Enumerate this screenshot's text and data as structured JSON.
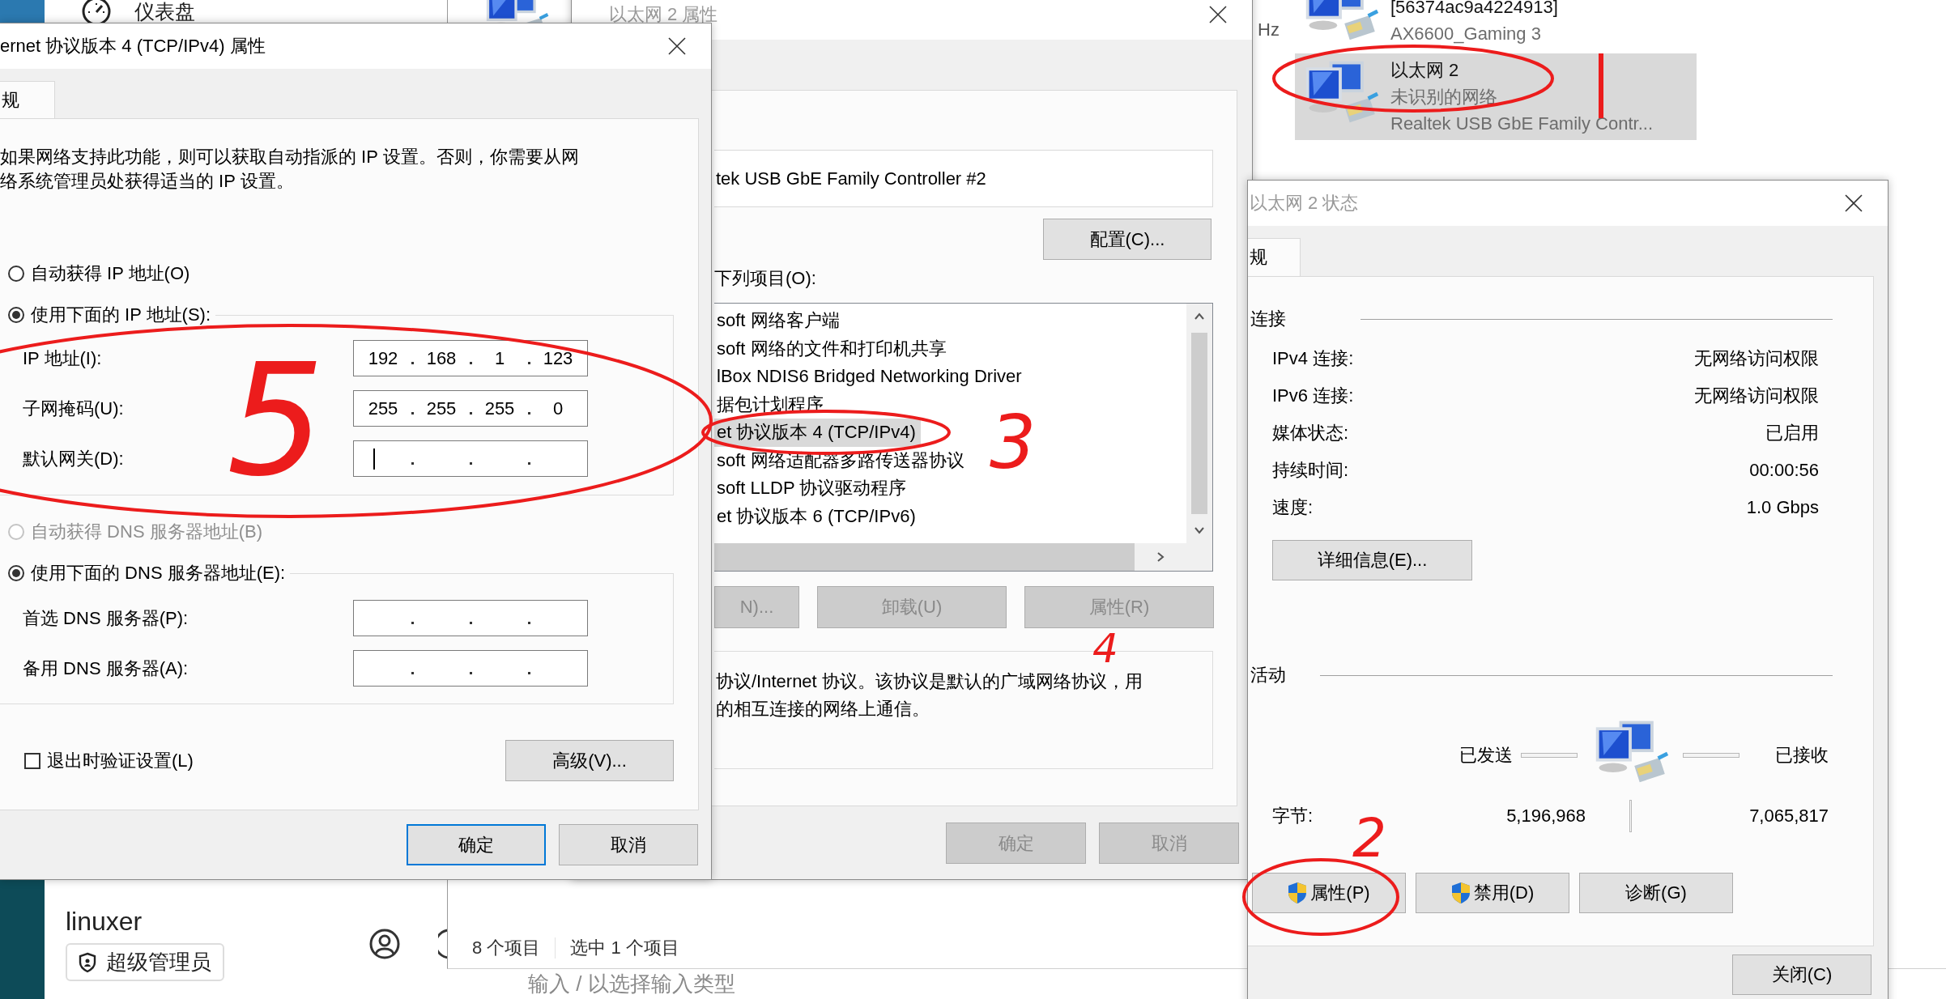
{
  "background_page": {
    "heading": "仪表盘",
    "user_name": "linuxer",
    "role_badge": "超级管理员",
    "input_hint": "输入 / 以选择输入类型"
  },
  "explorer": {
    "column_fragment": "Hz",
    "connections": [
      {
        "lines": [
          "[56374ac9a4224913]",
          "AX6600_Gaming 3"
        ],
        "selected": false
      },
      {
        "lines": [
          "以太网 2",
          "未识别的网络",
          "Realtek USB GbE Family Contr..."
        ],
        "selected": true
      }
    ],
    "status_items": [
      "8 个项目",
      "选中 1 个项目"
    ]
  },
  "adapter_properties": {
    "title": "以太网 2 属性",
    "adapter": "tek USB GbE Family Controller #2",
    "configure_button": "配置(C)...",
    "items_label": "下列项目(O):",
    "items": [
      {
        "label": "soft 网络客户端",
        "selected": false
      },
      {
        "label": "soft 网络的文件和打印机共享",
        "selected": false
      },
      {
        "label": "lBox NDIS6 Bridged Networking Driver",
        "selected": false
      },
      {
        "label": "据包计划程序",
        "selected": false
      },
      {
        "label": "et 协议版本 4 (TCP/IPv4)",
        "selected": true
      },
      {
        "label": "soft 网络适配器多路传送器协议",
        "selected": false
      },
      {
        "label": "soft LLDP 协议驱动程序",
        "selected": false
      },
      {
        "label": "et 协议版本 6 (TCP/IPv6)",
        "selected": false
      }
    ],
    "item_buttons": [
      {
        "label": "N)...",
        "disabled": true
      },
      {
        "label": "卸载(U)",
        "disabled": true
      },
      {
        "label": "属性(R)",
        "disabled": true
      }
    ],
    "description": [
      "协议/Internet 协议。该协议是默认的广域网络协议，用",
      "的相互连接的网络上通信。"
    ],
    "buttons": [
      {
        "label": "确定",
        "disabled": true
      },
      {
        "label": "取消",
        "disabled": true
      }
    ]
  },
  "ipv4_dialog": {
    "title": "ernet 协议版本 4 (TCP/IPv4) 属性",
    "tab": {
      "label": "规",
      "selected": true
    },
    "intro": [
      "如果网络支持此功能，则可以获取自动指派的 IP 设置。否则，你需要从网",
      "络系统管理员处获得适当的 IP 设置。"
    ],
    "ip_modes": [
      {
        "label": "自动获得 IP 地址(O)",
        "selected": false,
        "disabled": false
      },
      {
        "label": "使用下面的 IP 地址(S):",
        "selected": true,
        "disabled": false
      }
    ],
    "ip_fields": [
      {
        "label": "IP 地址(I):",
        "octets": [
          "192",
          "168",
          "1",
          "123"
        ],
        "cursor": false
      },
      {
        "label": "子网掩码(U):",
        "octets": [
          "255",
          "255",
          "255",
          "0"
        ],
        "cursor": false
      },
      {
        "label": "默认网关(D):",
        "cursor": true
      }
    ],
    "dns_modes": [
      {
        "label": "自动获得 DNS 服务器地址(B)",
        "selected": false,
        "disabled": true
      },
      {
        "label": "使用下面的 DNS 服务器地址(E):",
        "selected": true,
        "disabled": false
      }
    ],
    "dns_fields": [
      {
        "label": "首选 DNS 服务器(P):",
        "cursor": false
      },
      {
        "label": "备用 DNS 服务器(A):",
        "cursor": false
      }
    ],
    "validate_checkbox": {
      "label": "退出时验证设置(L)",
      "checked": false
    },
    "advanced_button": "高级(V)...",
    "buttons": [
      {
        "label": "确定",
        "focused": true
      },
      {
        "label": "取消",
        "focused": false
      }
    ]
  },
  "status_dialog": {
    "title": "以太网 2 状态",
    "tab": {
      "label": "规",
      "selected": true
    },
    "connection_header": "连接",
    "rows": [
      {
        "label": "IPv4 连接:",
        "value": "无网络访问权限"
      },
      {
        "label": "IPv6 连接:",
        "value": "无网络访问权限"
      },
      {
        "label": "媒体状态:",
        "value": "已启用"
      },
      {
        "label": "持续时间:",
        "value": "00:00:56"
      },
      {
        "label": "速度:",
        "value": "1.0 Gbps"
      }
    ],
    "details_button": "详细信息(E)...",
    "activity_header": "活动",
    "sent_label": "已发送",
    "received_label": "已接收",
    "bytes_label": "字节:",
    "bytes_sent": "5,196,968",
    "bytes_received": "7,065,817",
    "buttons": [
      {
        "label": "属性(P)",
        "elevated": true
      },
      {
        "label": "禁用(D)",
        "elevated": true
      },
      {
        "label": "诊断(G)",
        "elevated": false
      }
    ],
    "close_button": "关闭(C)"
  },
  "annotations": [
    {
      "kind": "ellipse"
    },
    {
      "kind": "number",
      "text": "5"
    },
    {
      "kind": "ellipse"
    },
    {
      "kind": "number",
      "text": "3"
    },
    {
      "kind": "number",
      "text": "4"
    },
    {
      "kind": "ellipse"
    },
    {
      "kind": "line"
    },
    {
      "kind": "ellipse"
    },
    {
      "kind": "number",
      "text": "2"
    }
  ]
}
